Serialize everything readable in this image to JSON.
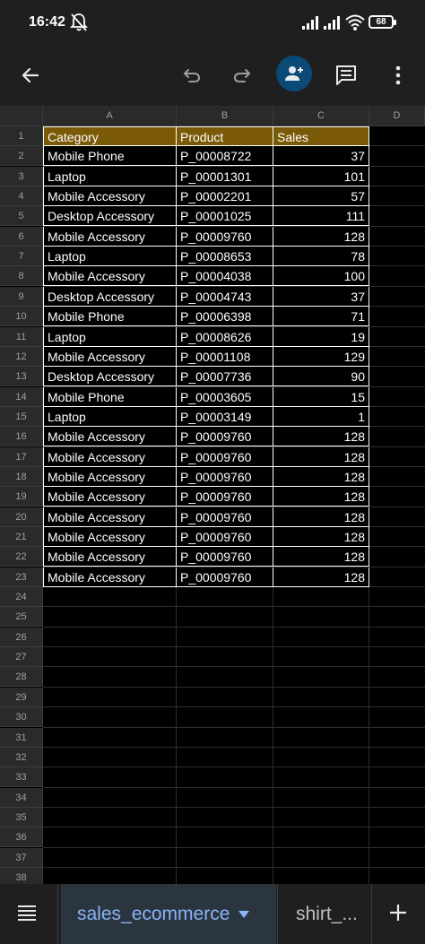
{
  "status_bar": {
    "time": "16:42",
    "battery": "68",
    "icons": [
      "bell-off-icon",
      "signal-icon",
      "signal-icon",
      "wifi-icon",
      "battery-icon"
    ]
  },
  "toolbar": {
    "icons": [
      "back-arrow-icon",
      "undo-icon",
      "redo-icon",
      "add-person-icon",
      "comment-icon",
      "more-vert-icon"
    ],
    "accent": "#0b4a76"
  },
  "grid": {
    "columns": [
      "A",
      "B",
      "C",
      "D"
    ],
    "rows": [
      "1",
      "2",
      "3",
      "4",
      "5",
      "6",
      "7",
      "8",
      "9",
      "10",
      "11",
      "12",
      "13",
      "14",
      "15",
      "16",
      "17",
      "18",
      "19",
      "20",
      "21",
      "22",
      "23",
      "24",
      "25",
      "26",
      "27",
      "28",
      "29",
      "30",
      "31",
      "32",
      "33",
      "34",
      "35",
      "36",
      "37",
      "38"
    ],
    "header": [
      "Category",
      "Product",
      "Sales"
    ],
    "header_color": "#7a5a06",
    "data": [
      [
        "Mobile Phone",
        "P_00008722",
        "37"
      ],
      [
        "Laptop",
        "P_00001301",
        "101"
      ],
      [
        "Mobile Accessory",
        "P_00002201",
        "57"
      ],
      [
        "Desktop Accessory",
        "P_00001025",
        "111"
      ],
      [
        "Mobile Accessory",
        "P_00009760",
        "128"
      ],
      [
        "Laptop",
        "P_00008653",
        "78"
      ],
      [
        "Mobile Accessory",
        "P_00004038",
        "100"
      ],
      [
        "Desktop Accessory",
        "P_00004743",
        "37"
      ],
      [
        "Mobile Phone",
        "P_00006398",
        "71"
      ],
      [
        "Laptop",
        "P_00008626",
        "19"
      ],
      [
        "Mobile Accessory",
        "P_00001108",
        "129"
      ],
      [
        "Desktop Accessory",
        "P_00007736",
        "90"
      ],
      [
        "Mobile Phone",
        "P_00003605",
        "15"
      ],
      [
        "Laptop",
        "P_00003149",
        "1"
      ],
      [
        "Mobile Accessory",
        "P_00009760",
        "128"
      ],
      [
        "Mobile Accessory",
        "P_00009760",
        "128"
      ],
      [
        "Mobile Accessory",
        "P_00009760",
        "128"
      ],
      [
        "Mobile Accessory",
        "P_00009760",
        "128"
      ],
      [
        "Mobile Accessory",
        "P_00009760",
        "128"
      ],
      [
        "Mobile Accessory",
        "P_00009760",
        "128"
      ],
      [
        "Mobile Accessory",
        "P_00009760",
        "128"
      ],
      [
        "Mobile Accessory",
        "P_00009760",
        "128"
      ]
    ]
  },
  "sheets": {
    "active": "sales_ecommerce",
    "other": "shirt_...",
    "icons": [
      "menu-icon",
      "dropdown-arrow-icon",
      "add-icon"
    ]
  }
}
